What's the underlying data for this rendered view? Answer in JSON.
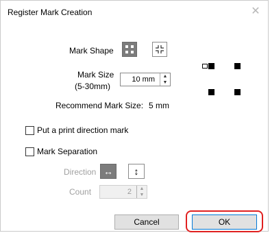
{
  "title": "Register Mark Creation",
  "close_icon": "close-icon",
  "mark_shape": {
    "label": "Mark Shape",
    "selected": "four-square",
    "options": [
      "four-square-icon",
      "corner-marks-icon"
    ]
  },
  "mark_size": {
    "label_line1": "Mark Size",
    "label_line2": "(5-30mm)",
    "value": "10 mm"
  },
  "recommend": {
    "label": "Recommend Mark Size:",
    "value": "5 mm"
  },
  "print_direction": {
    "label": "Put a print direction mark",
    "checked": false
  },
  "mark_separation": {
    "label": "Mark Separation",
    "checked": false,
    "direction_label": "Direction",
    "direction_selected": "horizontal",
    "direction_icons": [
      "horizontal-arrow-icon",
      "vertical-arrow-icon"
    ],
    "count_label": "Count",
    "count_value": "2"
  },
  "buttons": {
    "cancel": "Cancel",
    "ok": "OK"
  },
  "colors": {
    "selected_button": "#7c7c7c",
    "highlight": "#e02020",
    "default_button_border": "#0078d7"
  }
}
